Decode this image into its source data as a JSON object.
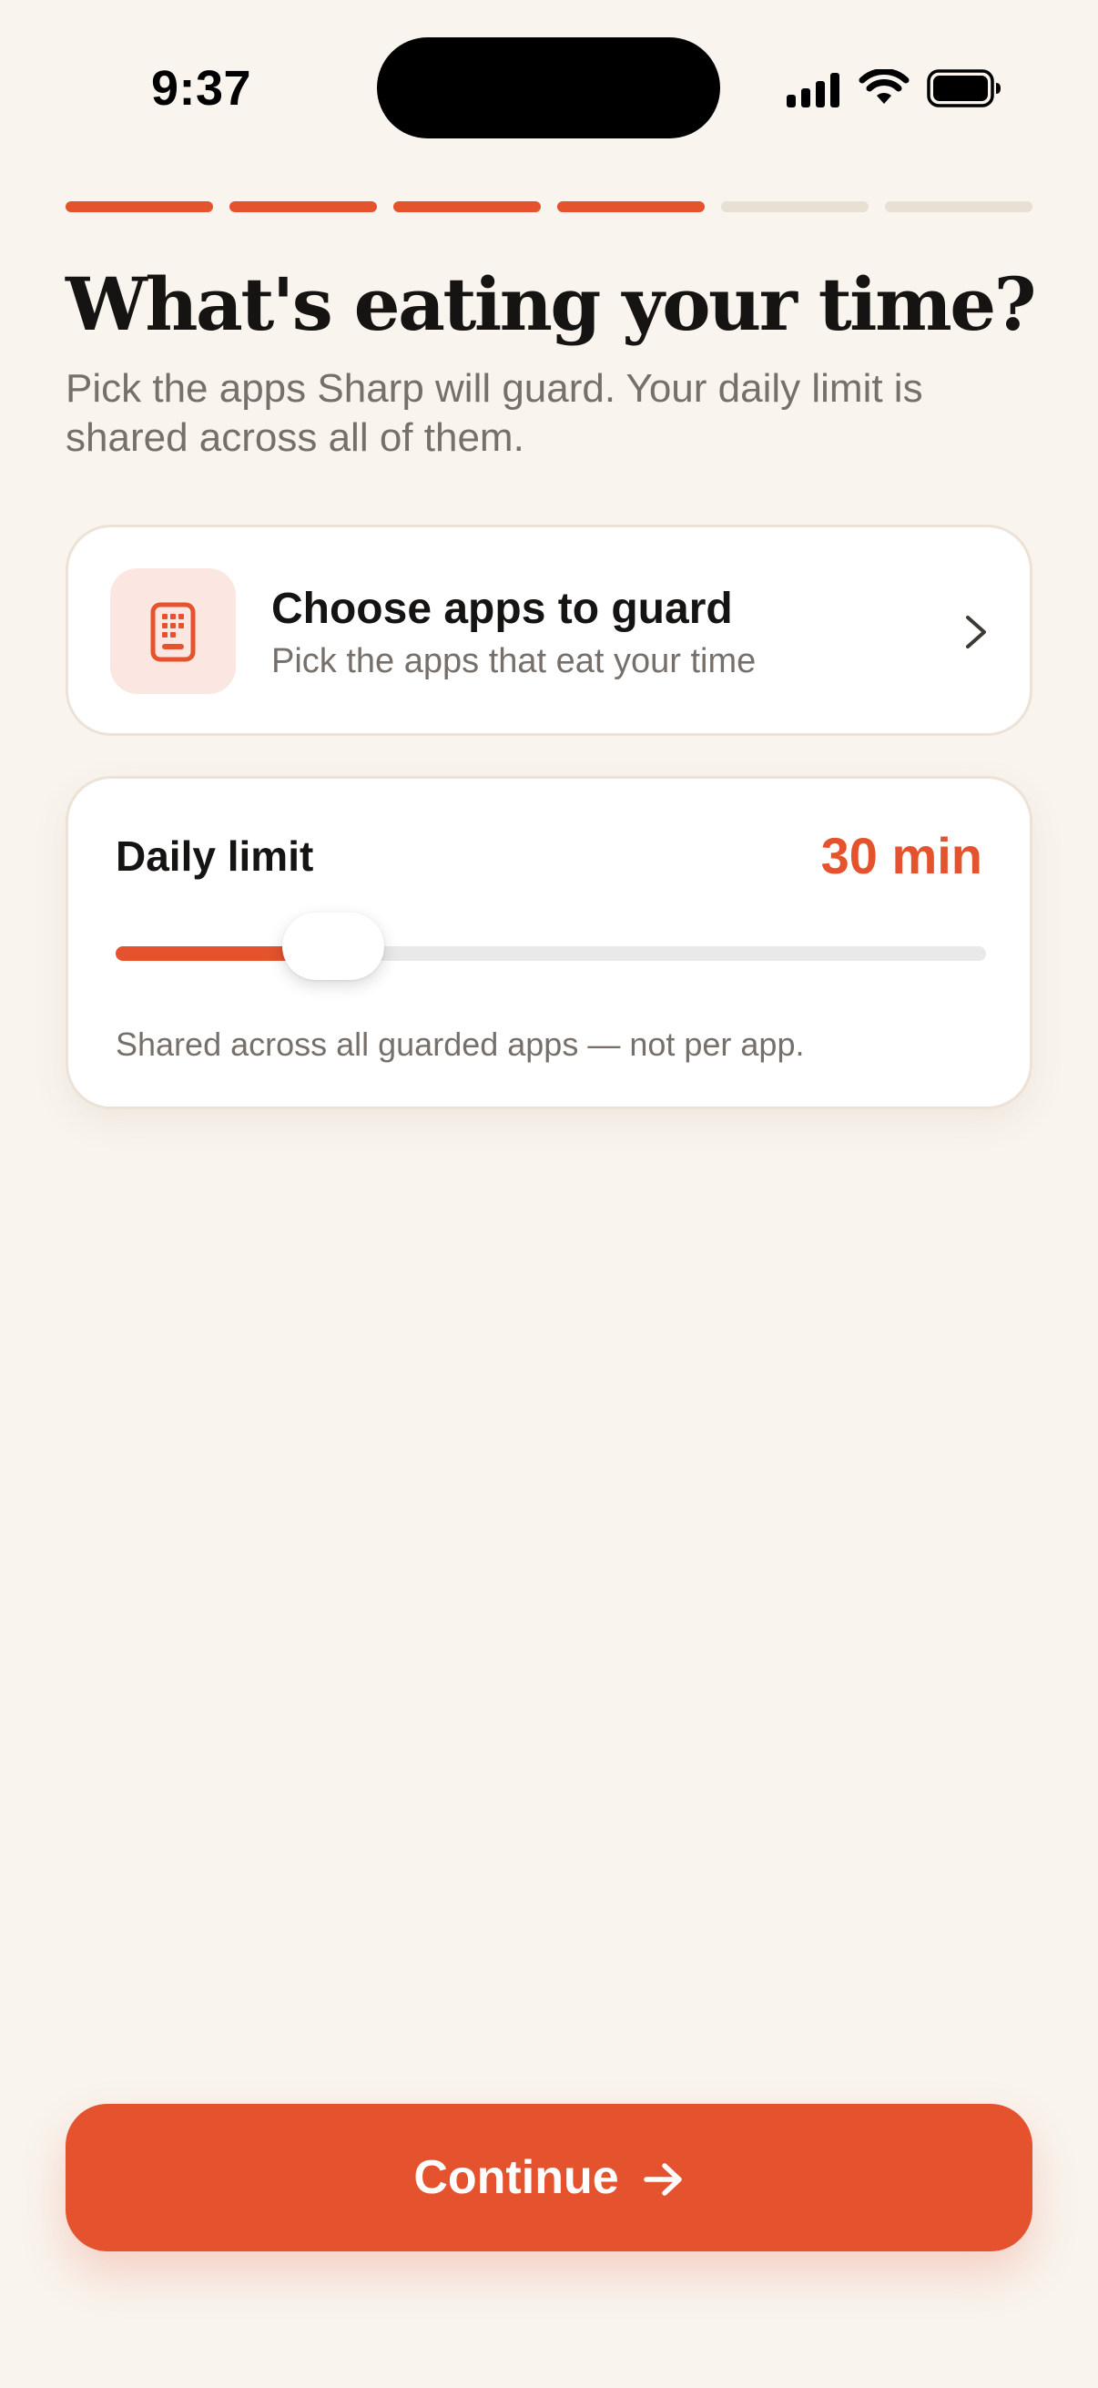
{
  "status_bar": {
    "time": "9:37",
    "icons": [
      "signal-icon",
      "wifi-icon",
      "battery-icon"
    ]
  },
  "progress": {
    "total_steps": 6,
    "completed_steps": 4
  },
  "header": {
    "title": "What's eating your time?",
    "subtitle": "Pick the apps Sharp will guard. Your daily limit is shared across all of them."
  },
  "apps_card": {
    "icon": "phone-grid-icon",
    "title": "Choose apps to guard",
    "subtitle": "Pick the apps that eat your time"
  },
  "limit_card": {
    "label": "Daily limit",
    "value": "30 min",
    "slider_fraction": 0.25,
    "note": "Shared across all guarded apps — not per app."
  },
  "continue_button": {
    "label": "Continue"
  },
  "colors": {
    "accent": "#e4522e",
    "background": "#f9f4ee",
    "muted_text": "#77706a",
    "progress_inactive": "#e7e0d3"
  }
}
